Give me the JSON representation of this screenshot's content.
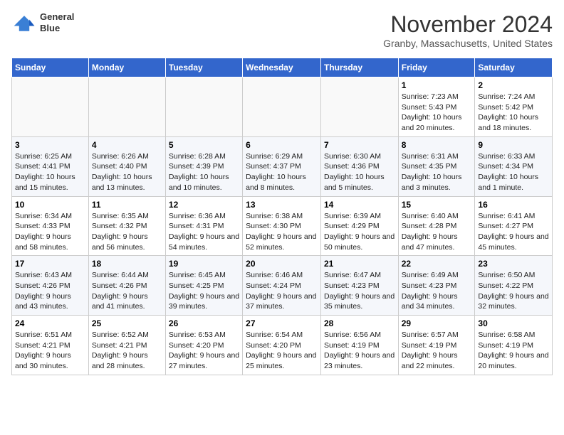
{
  "header": {
    "logo_line1": "General",
    "logo_line2": "Blue",
    "month": "November 2024",
    "location": "Granby, Massachusetts, United States"
  },
  "weekdays": [
    "Sunday",
    "Monday",
    "Tuesday",
    "Wednesday",
    "Thursday",
    "Friday",
    "Saturday"
  ],
  "weeks": [
    [
      {
        "day": "",
        "info": ""
      },
      {
        "day": "",
        "info": ""
      },
      {
        "day": "",
        "info": ""
      },
      {
        "day": "",
        "info": ""
      },
      {
        "day": "",
        "info": ""
      },
      {
        "day": "1",
        "info": "Sunrise: 7:23 AM\nSunset: 5:43 PM\nDaylight: 10 hours and 20 minutes."
      },
      {
        "day": "2",
        "info": "Sunrise: 7:24 AM\nSunset: 5:42 PM\nDaylight: 10 hours and 18 minutes."
      }
    ],
    [
      {
        "day": "3",
        "info": "Sunrise: 6:25 AM\nSunset: 4:41 PM\nDaylight: 10 hours and 15 minutes."
      },
      {
        "day": "4",
        "info": "Sunrise: 6:26 AM\nSunset: 4:40 PM\nDaylight: 10 hours and 13 minutes."
      },
      {
        "day": "5",
        "info": "Sunrise: 6:28 AM\nSunset: 4:39 PM\nDaylight: 10 hours and 10 minutes."
      },
      {
        "day": "6",
        "info": "Sunrise: 6:29 AM\nSunset: 4:37 PM\nDaylight: 10 hours and 8 minutes."
      },
      {
        "day": "7",
        "info": "Sunrise: 6:30 AM\nSunset: 4:36 PM\nDaylight: 10 hours and 5 minutes."
      },
      {
        "day": "8",
        "info": "Sunrise: 6:31 AM\nSunset: 4:35 PM\nDaylight: 10 hours and 3 minutes."
      },
      {
        "day": "9",
        "info": "Sunrise: 6:33 AM\nSunset: 4:34 PM\nDaylight: 10 hours and 1 minute."
      }
    ],
    [
      {
        "day": "10",
        "info": "Sunrise: 6:34 AM\nSunset: 4:33 PM\nDaylight: 9 hours and 58 minutes."
      },
      {
        "day": "11",
        "info": "Sunrise: 6:35 AM\nSunset: 4:32 PM\nDaylight: 9 hours and 56 minutes."
      },
      {
        "day": "12",
        "info": "Sunrise: 6:36 AM\nSunset: 4:31 PM\nDaylight: 9 hours and 54 minutes."
      },
      {
        "day": "13",
        "info": "Sunrise: 6:38 AM\nSunset: 4:30 PM\nDaylight: 9 hours and 52 minutes."
      },
      {
        "day": "14",
        "info": "Sunrise: 6:39 AM\nSunset: 4:29 PM\nDaylight: 9 hours and 50 minutes."
      },
      {
        "day": "15",
        "info": "Sunrise: 6:40 AM\nSunset: 4:28 PM\nDaylight: 9 hours and 47 minutes."
      },
      {
        "day": "16",
        "info": "Sunrise: 6:41 AM\nSunset: 4:27 PM\nDaylight: 9 hours and 45 minutes."
      }
    ],
    [
      {
        "day": "17",
        "info": "Sunrise: 6:43 AM\nSunset: 4:26 PM\nDaylight: 9 hours and 43 minutes."
      },
      {
        "day": "18",
        "info": "Sunrise: 6:44 AM\nSunset: 4:26 PM\nDaylight: 9 hours and 41 minutes."
      },
      {
        "day": "19",
        "info": "Sunrise: 6:45 AM\nSunset: 4:25 PM\nDaylight: 9 hours and 39 minutes."
      },
      {
        "day": "20",
        "info": "Sunrise: 6:46 AM\nSunset: 4:24 PM\nDaylight: 9 hours and 37 minutes."
      },
      {
        "day": "21",
        "info": "Sunrise: 6:47 AM\nSunset: 4:23 PM\nDaylight: 9 hours and 35 minutes."
      },
      {
        "day": "22",
        "info": "Sunrise: 6:49 AM\nSunset: 4:23 PM\nDaylight: 9 hours and 34 minutes."
      },
      {
        "day": "23",
        "info": "Sunrise: 6:50 AM\nSunset: 4:22 PM\nDaylight: 9 hours and 32 minutes."
      }
    ],
    [
      {
        "day": "24",
        "info": "Sunrise: 6:51 AM\nSunset: 4:21 PM\nDaylight: 9 hours and 30 minutes."
      },
      {
        "day": "25",
        "info": "Sunrise: 6:52 AM\nSunset: 4:21 PM\nDaylight: 9 hours and 28 minutes."
      },
      {
        "day": "26",
        "info": "Sunrise: 6:53 AM\nSunset: 4:20 PM\nDaylight: 9 hours and 27 minutes."
      },
      {
        "day": "27",
        "info": "Sunrise: 6:54 AM\nSunset: 4:20 PM\nDaylight: 9 hours and 25 minutes."
      },
      {
        "day": "28",
        "info": "Sunrise: 6:56 AM\nSunset: 4:19 PM\nDaylight: 9 hours and 23 minutes."
      },
      {
        "day": "29",
        "info": "Sunrise: 6:57 AM\nSunset: 4:19 PM\nDaylight: 9 hours and 22 minutes."
      },
      {
        "day": "30",
        "info": "Sunrise: 6:58 AM\nSunset: 4:19 PM\nDaylight: 9 hours and 20 minutes."
      }
    ]
  ]
}
